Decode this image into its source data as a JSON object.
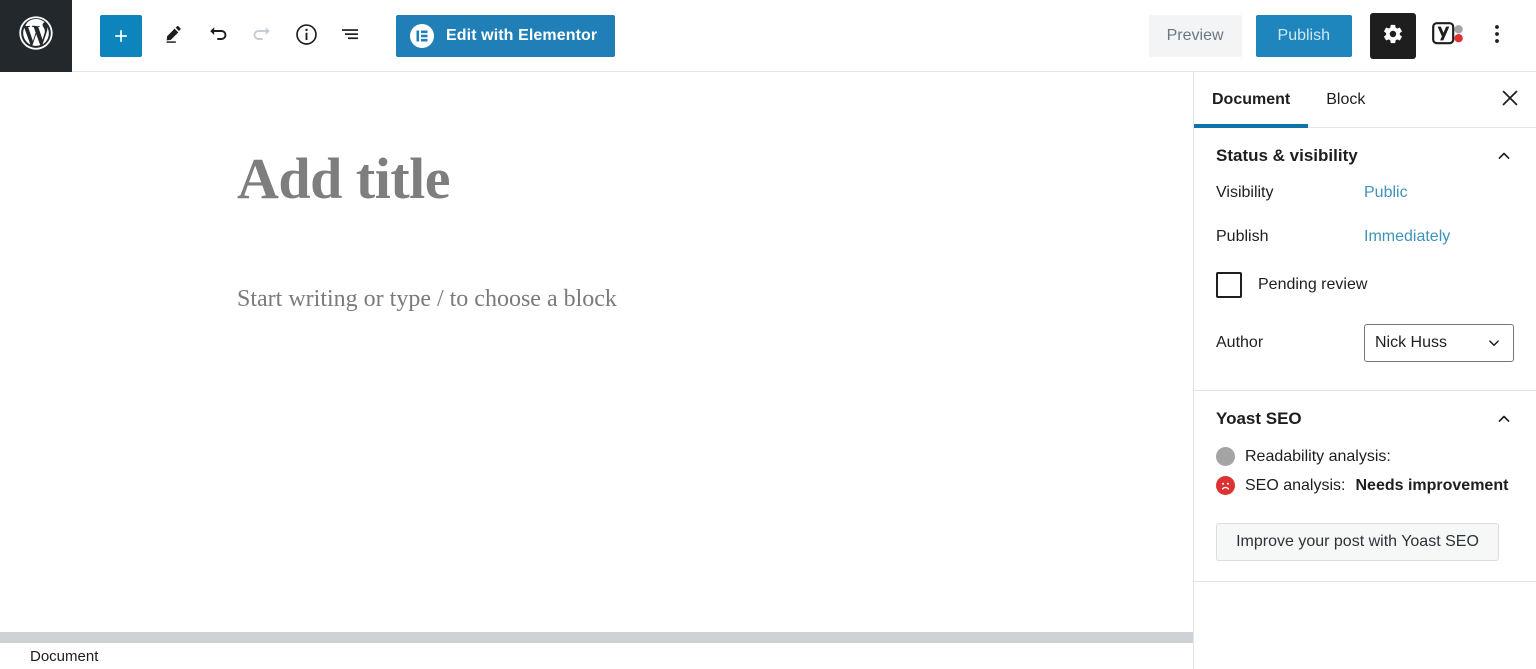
{
  "toolbar": {
    "wp_logo_name": "wordpress-logo",
    "add_block_label": "+",
    "edit_mode_icon": "pencil-icon",
    "undo_icon": "undo-icon",
    "redo_icon": "redo-icon",
    "info_icon": "info-icon",
    "list_view_icon": "list-view-icon",
    "elementor_label": "Edit with Elementor",
    "preview_label": "Preview",
    "publish_label": "Publish",
    "settings_icon": "gear-icon",
    "yoast_icon": "yoast-seo-icon",
    "more_icon": "kebab-menu-icon"
  },
  "editor": {
    "title_placeholder": "Add title",
    "body_placeholder": "Start writing or type / to choose a block"
  },
  "sidebar": {
    "tabs": [
      {
        "label": "Document",
        "active": true
      },
      {
        "label": "Block",
        "active": false
      }
    ],
    "close_label": "×",
    "status_panel": {
      "title": "Status & visibility",
      "visibility_label": "Visibility",
      "visibility_value": "Public",
      "publish_label": "Publish",
      "publish_value": "Immediately",
      "pending_review_label": "Pending review",
      "pending_review_checked": false,
      "author_label": "Author",
      "author_value": "Nick Huss"
    },
    "yoast_panel": {
      "title": "Yoast SEO",
      "readability_label": "Readability analysis:",
      "readability_value": "",
      "seo_label": "SEO analysis:",
      "seo_value": "Needs improvement",
      "cta_label": "Improve your post with Yoast SEO"
    }
  },
  "footer": {
    "breadcrumb": "Document"
  },
  "colors": {
    "wp_admin_bar": "#23282d",
    "accent_blue": "#0e84bd",
    "elementor_blue": "#1f7fb6",
    "publish_blue": "#1f85bd",
    "link_blue": "#3e93b8",
    "tab_underline": "#0e75a8",
    "seo_red": "#dc3232",
    "readability_gray": "#a4a4a4",
    "scrollbar_gray": "#cdd2d6"
  }
}
